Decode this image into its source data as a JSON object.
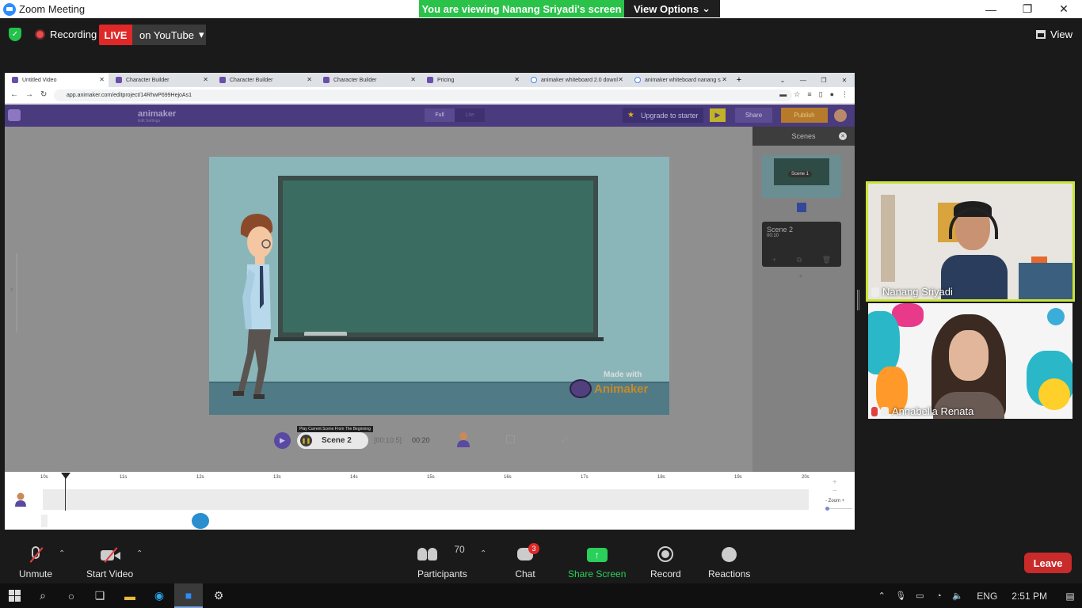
{
  "window": {
    "title": "Zoom Meeting",
    "controls": [
      "—",
      "❐",
      "✕"
    ]
  },
  "banner": {
    "viewing": "You are viewing Nanang Sriyadi's screen",
    "view_options": "View Options"
  },
  "status": {
    "recording": "Recording",
    "live": "LIVE",
    "platform": "on YouTube",
    "view": "View"
  },
  "browser": {
    "tabs": [
      {
        "title": "Untitled Video"
      },
      {
        "title": "Character Builder"
      },
      {
        "title": "Character Builder"
      },
      {
        "title": "Character Builder"
      },
      {
        "title": "Pricing"
      },
      {
        "title": "animaker whiteboard 2.0 downl"
      },
      {
        "title": "animaker whiteboard nanang s"
      }
    ],
    "url": "app.animaker.com/editproject/14RhwP699HejoAs1"
  },
  "animaker": {
    "name": "animaker",
    "subtitle": "Edit Settings",
    "mode_full": "Full",
    "mode_lite": "Lite",
    "upgrade": "Upgrade to starter",
    "share": "Share",
    "publish": "Publish",
    "scenes_title": "Scenes",
    "scene1_label": "Scene 1",
    "scene2_label": "Scene 2",
    "scene2_duration": "00:10",
    "canvas_made_with": "Made with",
    "canvas_brand": "Animaker",
    "tooltip": "Play Current Scene From The Beginning",
    "current_scene": "Scene 2",
    "current_time": "[00:10.5]",
    "total_time": "00:20",
    "zoom_label": "Zoom",
    "timeline_ticks": [
      "10s",
      "11s",
      "12s",
      "13s",
      "14s",
      "15s",
      "16s",
      "17s",
      "18s",
      "19s",
      "20s"
    ]
  },
  "participants_video": [
    {
      "name": "Nanang Sriyadi"
    },
    {
      "name": "Annabella Renata"
    }
  ],
  "toolbar": {
    "unmute": "Unmute",
    "start_video": "Start Video",
    "participants": "Participants",
    "participants_count": "70",
    "chat": "Chat",
    "chat_badge": "3",
    "share_screen": "Share Screen",
    "record": "Record",
    "reactions": "Reactions",
    "leave": "Leave"
  },
  "taskbar": {
    "language": "ENG",
    "time": "2:51 PM"
  },
  "colors": {
    "zoom_blue": "#2d8cff",
    "banner_green": "#2bc24a",
    "live_red": "#e02828",
    "animaker_purple": "#4a3a7e",
    "speaker_highlight": "#c9e339"
  }
}
